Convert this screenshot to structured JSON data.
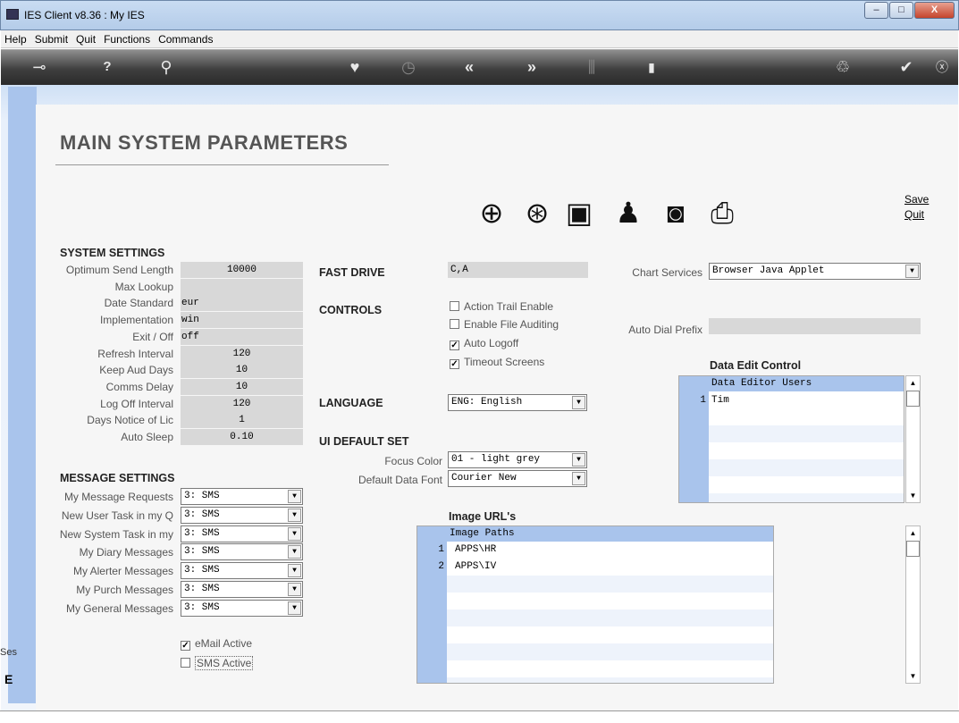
{
  "window": {
    "title": "IES Client v8.36 : My IES",
    "min": "–",
    "max": "□",
    "close": "X"
  },
  "menu": [
    "Help",
    "Submit",
    "Quit",
    "Functions",
    "Commands"
  ],
  "toolbar_icons": [
    "key-icon",
    "help-icon",
    "search-icon",
    "heart-icon",
    "clock-icon",
    "back-icon",
    "forward-icon",
    "tools-icon",
    "copy-icon",
    "recycle-icon",
    "check-icon",
    "close-icon"
  ],
  "page_title": "MAIN SYSTEM PARAMETERS",
  "actions": {
    "save": "Save",
    "quit": "Quit"
  },
  "system_settings": {
    "heading": "SYSTEM SETTINGS",
    "rows": [
      {
        "label": "Optimum Send Length",
        "value": "10000"
      },
      {
        "label": "Max Lookup",
        "value": ""
      },
      {
        "label": "Date Standard",
        "value": "eur"
      },
      {
        "label": "Implementation",
        "value": "win"
      },
      {
        "label": "Exit / Off",
        "value": "off"
      },
      {
        "label": "Refresh Interval",
        "value": "120"
      },
      {
        "label": "Keep Aud Days",
        "value": "10"
      },
      {
        "label": "Comms Delay",
        "value": "10"
      },
      {
        "label": "Log Off Interval",
        "value": "120"
      },
      {
        "label": "Days Notice of Lic",
        "value": "1"
      },
      {
        "label": "Auto Sleep",
        "value": "0.10"
      }
    ]
  },
  "message_settings": {
    "heading": "MESSAGE SETTINGS",
    "rows": [
      {
        "label": "My Message Requests",
        "value": "3: SMS"
      },
      {
        "label": "New User Task in my Q",
        "value": "3: SMS"
      },
      {
        "label": "New System Task in my",
        "value": "3: SMS"
      },
      {
        "label": "My Diary Messages",
        "value": "3: SMS"
      },
      {
        "label": "My Alerter Messages",
        "value": "3: SMS"
      },
      {
        "label": "My Purch Messages",
        "value": "3: SMS"
      },
      {
        "label": "My General Messages",
        "value": "3: SMS"
      }
    ],
    "email_active": {
      "label": "eMail Active",
      "checked": true
    },
    "sms_active": {
      "label": "SMS Active",
      "checked": false
    }
  },
  "fast_drive": {
    "label": "FAST DRIVE",
    "value": "C,A"
  },
  "controls": {
    "label": "CONTROLS",
    "items": [
      {
        "label": "Action Trail Enable",
        "checked": false
      },
      {
        "label": "Enable File Auditing",
        "checked": false
      },
      {
        "label": "Auto Logoff",
        "checked": true
      },
      {
        "label": "Timeout Screens",
        "checked": true
      }
    ]
  },
  "language": {
    "label": "LANGUAGE",
    "value": "ENG: English"
  },
  "ui_default": {
    "label": "UI DEFAULT SET",
    "focus_color": {
      "label": "Focus Color",
      "value": "01 - light grey"
    },
    "data_font": {
      "label": "Default Data Font",
      "value": "Courier New"
    }
  },
  "chart_services": {
    "label": "Chart Services",
    "value": "Browser Java Applet"
  },
  "auto_dial": {
    "label": "Auto Dial Prefix",
    "value": ""
  },
  "data_edit": {
    "label": "Data Edit Control",
    "header": "Data Editor Users",
    "rows": [
      {
        "n": "1",
        "v": "Tim"
      }
    ]
  },
  "image_urls": {
    "label": "Image URL's",
    "header": "Image Paths",
    "rows": [
      {
        "n": "1",
        "v": "APPS\\HR"
      },
      {
        "n": "2",
        "v": "APPS\\IV"
      }
    ]
  },
  "side_fragment": {
    "text1": "Ses",
    "text2": "E"
  },
  "status": {
    "colors": {
      "grid_number": "#a9c4ec",
      "toolbar": "#3f3f3f"
    }
  }
}
